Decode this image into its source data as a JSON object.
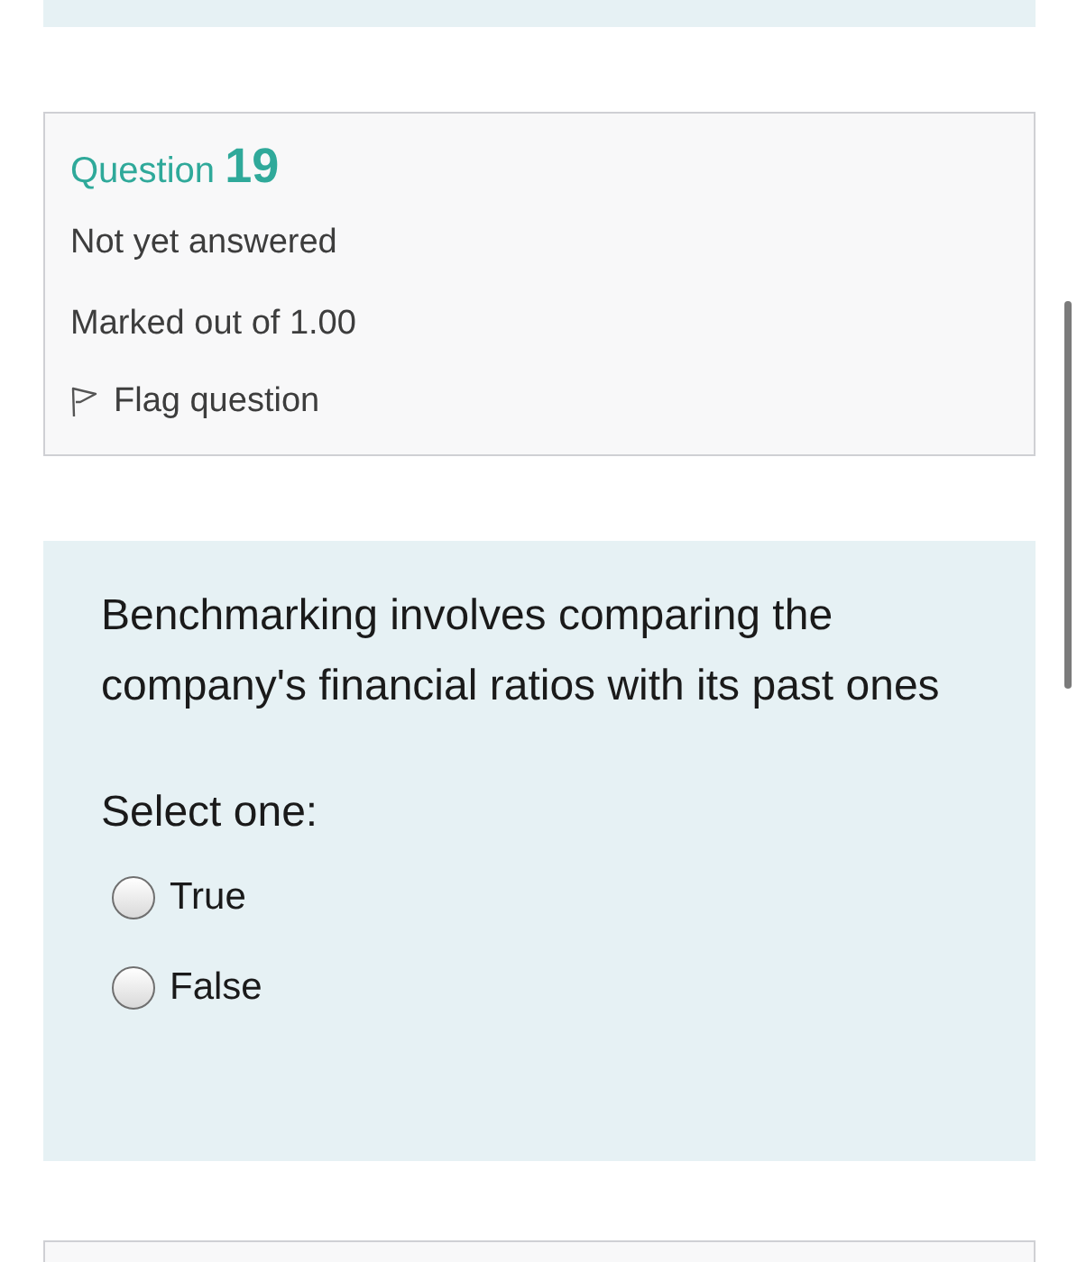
{
  "question_info": {
    "title": "Question **19**",
    "status": "Not yet answered",
    "marks": "Marked out of 1.00",
    "flag": {
      "label": "Flag question",
      "flagged": false
    }
  },
  "question": {
    "text": "Benchmarking involves comparing the company's financial ratios with its past ones",
    "prompt": "Select one:",
    "options": [
      {
        "label": "True",
        "selected": false
      },
      {
        "label": "False",
        "selected": false
      }
    ]
  }
}
